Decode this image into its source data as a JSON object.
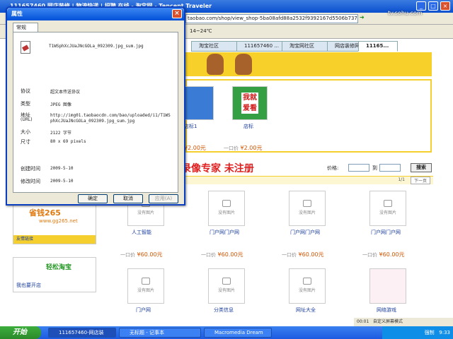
{
  "browser": {
    "title": "111657460 网店装修 | 物流快递 | 招聘 在线 - 淘宝网 - Tencent Traveler",
    "url": "taobao.com/shop/view_shop-5ba08afd88a2532f9392167d5506b737",
    "weather": "14~24℃",
    "tabs": [
      "淘宝社区",
      "111657460 ...",
      "淘宝网社区",
      "网店装修网",
      "11165..."
    ],
    "watermark_logo": "tv.sohu.com"
  },
  "page": {
    "yellow_box": {
      "item1": {
        "caption": "店标1",
        "price_label": "一口价",
        "price": "¥2.00元"
      },
      "item2": {
        "caption": "店标",
        "badge_top": "我就",
        "badge_bottom": "爱看",
        "price_label": "一口价",
        "price": "¥2.00元"
      }
    },
    "recorder_watermark": "屏幕录像专家  未注册",
    "search": {
      "price_label": "价格:",
      "to": "到",
      "button": "搜索"
    },
    "pager": {
      "info": "1/1",
      "next": "下一页"
    },
    "left_ads": [
      {
        "brand": "省钱265",
        "url": "www.gg265.net",
        "caption": "友情链接"
      },
      {
        "brand": "轻松淘宝",
        "caption": "我也要开店"
      }
    ],
    "grid_no_image": "没有图片",
    "grid_row1": [
      {
        "caption": "人工智能",
        "price_label": "一口价",
        "price": "¥60.00元"
      },
      {
        "caption": "门户网门户网",
        "price_label": "一口价",
        "price": "¥60.00元"
      },
      {
        "caption": "门户网门户网",
        "price_label": "一口价",
        "price": "¥60.00元"
      },
      {
        "caption": "门户网门户网",
        "price_label": "一口价",
        "price": "¥60.00元"
      }
    ],
    "grid_row2": [
      {
        "caption": "门户网"
      },
      {
        "caption": "分类信息"
      },
      {
        "caption": "网址大全"
      },
      {
        "caption": "网络游戏"
      }
    ]
  },
  "dialog": {
    "title": "属性",
    "tab": "常规",
    "filename": "T1WSphXcJUaJNcGOLa_092309.jpg_sum.jpg",
    "rows": [
      {
        "label": "协议",
        "value": "超文本传送协议"
      },
      {
        "label": "类型",
        "value": "JPEG 图像"
      },
      {
        "label": "地址",
        "label2": "(URL)",
        "value": "http://img01.taobaocdn.com/bao/uploaded/i1/T1WS",
        "value2": "phXcJUaJNcGOLa_092309.jpg_sum.jpg"
      },
      {
        "label": "大小",
        "value": "2122 字节"
      },
      {
        "label": "尺寸",
        "value": "80 x 69 pixels"
      }
    ],
    "dates": [
      {
        "label": "创建时间",
        "value": "2009-5-10"
      },
      {
        "label": "修改时间",
        "value": "2009-5-10"
      }
    ],
    "ok": "确定",
    "cancel": "取消",
    "apply": "应用(A)"
  },
  "taskbar": {
    "start": "开始",
    "tasks": [
      "111657460-网店装",
      "无标题 - 记事本",
      "Macromedia Dream"
    ],
    "status_zone": "自定义屏幕模式",
    "status_num": "00:01",
    "tray_time": "9:33",
    "tray_label": "强制"
  }
}
